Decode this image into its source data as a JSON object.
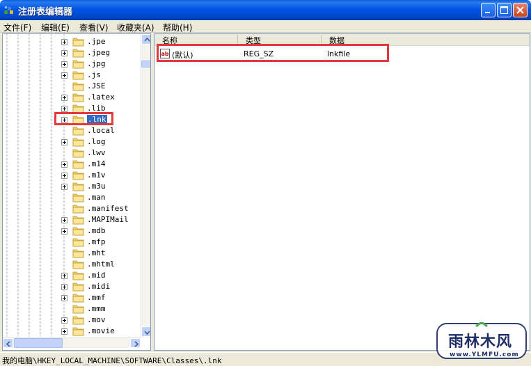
{
  "window": {
    "title": "注册表编辑器"
  },
  "menu": [
    "文件(F)",
    "编辑(E)",
    "查看(V)",
    "收藏夹(A)",
    "帮助(H)"
  ],
  "tree": {
    "items": [
      {
        "label": ".jpe",
        "expandable": true
      },
      {
        "label": ".jpeg",
        "expandable": true
      },
      {
        "label": ".jpg",
        "expandable": true
      },
      {
        "label": ".js",
        "expandable": true
      },
      {
        "label": ".JSE",
        "expandable": false
      },
      {
        "label": ".latex",
        "expandable": true
      },
      {
        "label": ".lib",
        "expandable": true
      },
      {
        "label": ".lnk",
        "expandable": true,
        "selected": true
      },
      {
        "label": ".local",
        "expandable": false
      },
      {
        "label": ".log",
        "expandable": true
      },
      {
        "label": ".lwv",
        "expandable": false
      },
      {
        "label": ".m14",
        "expandable": true
      },
      {
        "label": ".m1v",
        "expandable": true
      },
      {
        "label": ".m3u",
        "expandable": true
      },
      {
        "label": ".man",
        "expandable": false
      },
      {
        "label": ".manifest",
        "expandable": false
      },
      {
        "label": ".MAPIMail",
        "expandable": true
      },
      {
        "label": ".mdb",
        "expandable": true
      },
      {
        "label": ".mfp",
        "expandable": false
      },
      {
        "label": ".mht",
        "expandable": false
      },
      {
        "label": ".mhtml",
        "expandable": false
      },
      {
        "label": ".mid",
        "expandable": true
      },
      {
        "label": ".midi",
        "expandable": true
      },
      {
        "label": ".mmf",
        "expandable": true
      },
      {
        "label": ".mmm",
        "expandable": false
      },
      {
        "label": ".mov",
        "expandable": true
      },
      {
        "label": ".movie",
        "expandable": true
      }
    ]
  },
  "list": {
    "columns": [
      "名称",
      "类型",
      "数据"
    ],
    "rows": [
      {
        "icon": "string-value-icon",
        "name": "(默认)",
        "type": "REG_SZ",
        "data": "lnkfile"
      }
    ]
  },
  "status": {
    "path": "我的电脑\\HKEY_LOCAL_MACHINE\\SOFTWARE\\Classes\\.lnk"
  },
  "watermark": {
    "title": "雨林木风",
    "url": "www.YLMFU.com"
  },
  "colors": {
    "titlebar": "#0055e5",
    "highlight": "#e23a3a",
    "selection": "#316ac5"
  }
}
